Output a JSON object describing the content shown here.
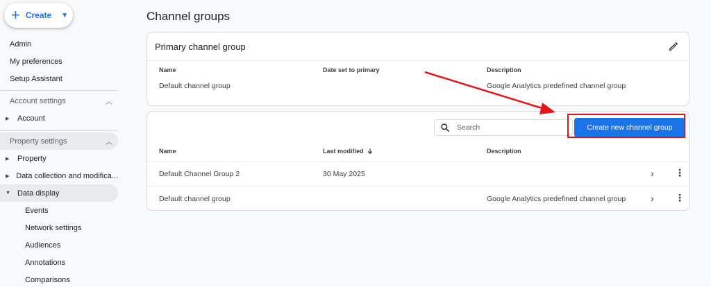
{
  "sidebar": {
    "create_label": "Create",
    "items": [
      {
        "label": "Admin"
      },
      {
        "label": "My preferences"
      },
      {
        "label": "Setup Assistant"
      }
    ],
    "account_section": "Account settings",
    "account_item": "Account",
    "property_section": "Property settings",
    "property_items": [
      {
        "label": "Property"
      },
      {
        "label": "Data collection and modifica..."
      },
      {
        "label": "Data display"
      }
    ],
    "data_display_children": [
      {
        "label": "Events"
      },
      {
        "label": "Network settings"
      },
      {
        "label": "Audiences"
      },
      {
        "label": "Annotations"
      },
      {
        "label": "Comparisons"
      }
    ]
  },
  "main": {
    "title": "Channel groups",
    "primary_card": {
      "title": "Primary channel group",
      "headers": [
        "Name",
        "Date set to primary",
        "Description"
      ],
      "row": [
        "Default channel group",
        "",
        "Google Analytics predefined channel group"
      ]
    },
    "list_card": {
      "search_placeholder": "Search",
      "create_button": "Create new channel group",
      "headers": [
        "Name",
        "Last modified",
        "Description"
      ],
      "sort_icon": "arrow-down-icon",
      "rows": [
        [
          "Default Channel Group 2",
          "30 May 2025",
          ""
        ],
        [
          "Default channel group",
          "",
          "Google Analytics predefined channel group"
        ]
      ]
    }
  },
  "colors": {
    "accent": "#1a73e8",
    "annotation": "#e4141b"
  }
}
